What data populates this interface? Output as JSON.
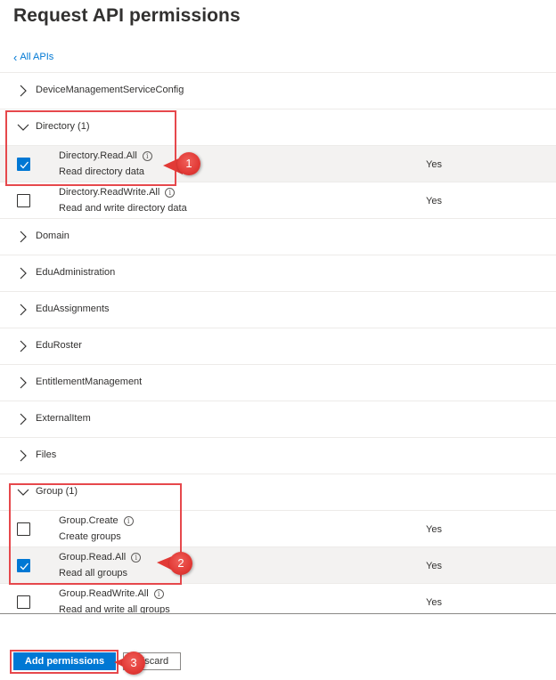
{
  "page": {
    "title": "Request API permissions",
    "back_link": "All APIs"
  },
  "rows": [
    {
      "type": "group",
      "label": "DeviceManagementServiceConfig",
      "expanded": false
    },
    {
      "type": "group",
      "label": "Directory (1)",
      "expanded": true
    },
    {
      "type": "permission",
      "name": "Directory.Read.All",
      "description": "Read directory data",
      "consent": "Yes",
      "checked": true
    },
    {
      "type": "permission",
      "name": "Directory.ReadWrite.All",
      "description": "Read and write directory data",
      "consent": "Yes",
      "checked": false
    },
    {
      "type": "group",
      "label": "Domain",
      "expanded": false
    },
    {
      "type": "group",
      "label": "EduAdministration",
      "expanded": false
    },
    {
      "type": "group",
      "label": "EduAssignments",
      "expanded": false
    },
    {
      "type": "group",
      "label": "EduRoster",
      "expanded": false
    },
    {
      "type": "group",
      "label": "EntitlementManagement",
      "expanded": false
    },
    {
      "type": "group",
      "label": "ExternalItem",
      "expanded": false
    },
    {
      "type": "group",
      "label": "Files",
      "expanded": false
    },
    {
      "type": "group",
      "label": "Group (1)",
      "expanded": true
    },
    {
      "type": "permission",
      "name": "Group.Create",
      "description": "Create groups",
      "consent": "Yes",
      "checked": false
    },
    {
      "type": "permission",
      "name": "Group.Read.All",
      "description": "Read all groups",
      "consent": "Yes",
      "checked": true
    },
    {
      "type": "permission",
      "name": "Group.ReadWrite.All",
      "description": "Read and write all groups",
      "consent": "Yes",
      "checked": false
    }
  ],
  "footer": {
    "add_label": "Add permissions",
    "discard_label": "Discard"
  },
  "callouts": [
    "1",
    "2",
    "3"
  ],
  "colors": {
    "accent": "#0078d4",
    "callout": "#e23a36",
    "highlight_border": "#e6484c"
  }
}
